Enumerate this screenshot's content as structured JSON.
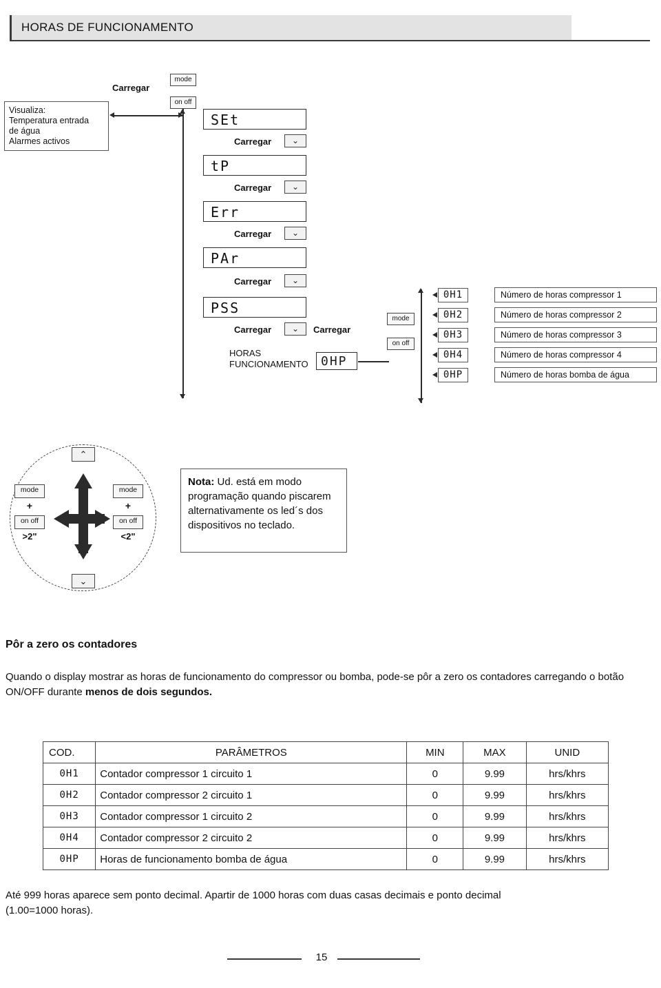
{
  "header": {
    "title": "HORAS DE FUNCIONAMENTO"
  },
  "visualiza": {
    "line1": "Visualiza:",
    "line2": "Temperatura entrada",
    "line3": "de água",
    "line4": "Alarmes activos"
  },
  "keys": {
    "mode": "mode",
    "onoff": "on  off",
    "plus": "+",
    "gt2": ">2\"",
    "lt2": "<2\"",
    "up_chevron": "⌃",
    "down_chevron": "⌄"
  },
  "flow": {
    "carregar": "Carregar",
    "horas_label_1": "HORAS",
    "horas_label_2": "FUNCIONAMENTO",
    "displays": [
      {
        "code": "SEt"
      },
      {
        "code": "tP"
      },
      {
        "code": "Err"
      },
      {
        "code": "PAr"
      },
      {
        "code": "PSS"
      }
    ],
    "horas_code": "0HP"
  },
  "counters": [
    {
      "code": "0H1",
      "label": "Número de horas  compressor 1"
    },
    {
      "code": "0H2",
      "label": "Número de horas  compressor 2"
    },
    {
      "code": "0H3",
      "label": "Número de horas  compressor 3"
    },
    {
      "code": "0H4",
      "label": "Número de horas  compressor 4"
    },
    {
      "code": "0HP",
      "label": "Número de horas bomba de água"
    }
  ],
  "nota": {
    "bold": "Nota:",
    "text": " Ud. está em modo programação quando piscarem alternativamente os led´s dos dispositivos no teclado."
  },
  "reset_section": {
    "title": "Pôr a zero os contadores",
    "text_part1": "Quando o display mostrar as horas de funcionamento do compressor ou bomba, pode-se pôr a zero os contadores carregando o botão ON/OFF durante ",
    "text_bold": "menos de dois segundos."
  },
  "table": {
    "headers": {
      "cod": "COD.",
      "param": "PARÂMETROS",
      "min": "MIN",
      "max": "MAX",
      "unid": "UNID"
    },
    "rows": [
      {
        "cod": "0H1",
        "param": "Contador compressor 1 circuito 1",
        "min": "0",
        "max": "9.99",
        "unid": "hrs/khrs"
      },
      {
        "cod": "0H2",
        "param": "Contador compressor 2 circuito 1",
        "min": "0",
        "max": "9.99",
        "unid": "hrs/khrs"
      },
      {
        "cod": "0H3",
        "param": "Contador compressor 1 circuito 2",
        "min": "0",
        "max": "9.99",
        "unid": "hrs/khrs"
      },
      {
        "cod": "0H4",
        "param": "Contador compressor 2 circuito 2",
        "min": "0",
        "max": "9.99",
        "unid": "hrs/khrs"
      },
      {
        "cod": "0HP",
        "param": "Horas de funcionamento bomba de água",
        "min": "0",
        "max": "9.99",
        "unid": "hrs/khrs"
      }
    ]
  },
  "footnote": {
    "line1": "Até 999 horas aparece sem ponto decimal. Apartir de 1000 horas com duas casas decimais e ponto decimal",
    "line2": "(1.00=1000 horas)."
  },
  "page": {
    "number": "15"
  }
}
